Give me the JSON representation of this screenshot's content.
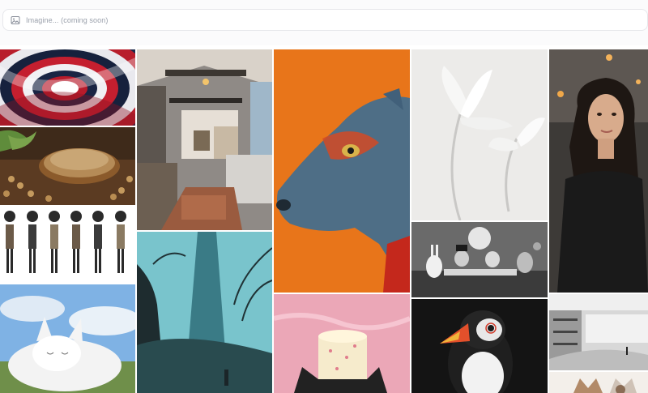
{
  "search": {
    "placeholder": "Imagine... (coming soon)",
    "icon": "image-icon"
  },
  "gallery": {
    "items": [
      {
        "subject": "optical illusion swirl"
      },
      {
        "subject": "spice bowl"
      },
      {
        "subject": "character turnaround sheet"
      },
      {
        "subject": "sleeping white cat"
      },
      {
        "subject": "tiny house interior"
      },
      {
        "subject": "misty dark spire"
      },
      {
        "subject": "dog portrait orange background"
      },
      {
        "subject": "cake slice pink background"
      },
      {
        "subject": "white flowers"
      },
      {
        "subject": "tea party cartoon characters"
      },
      {
        "subject": "puffin"
      },
      {
        "subject": "woman portrait"
      },
      {
        "subject": "modern white building"
      },
      {
        "subject": "cat and dog"
      }
    ]
  },
  "colors": {
    "bg": "#ffffff",
    "topbar": "#fbfbfc",
    "searchBorder": "#e6e7eb",
    "placeholder": "#9aa0ab"
  }
}
